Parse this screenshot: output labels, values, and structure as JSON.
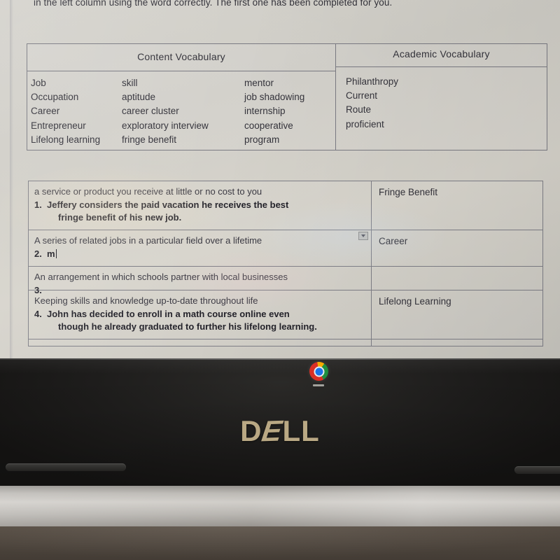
{
  "document": {
    "instruction": "in the left column using the word correctly. The first one has been completed for you."
  },
  "vocab_table": {
    "headers": {
      "content": "Content Vocabulary",
      "academic": "Academic Vocabulary"
    },
    "content_columns": [
      [
        "Job",
        "Occupation",
        "Career",
        "Entrepreneur",
        "Lifelong learning"
      ],
      [
        "skill",
        "aptitude",
        "career cluster",
        "exploratory interview",
        "fringe benefit"
      ],
      [
        "mentor",
        "job shadowing",
        "internship",
        "cooperative",
        "program"
      ]
    ],
    "academic_words": [
      "Philanthropy",
      "Current",
      "Route",
      "proficient"
    ]
  },
  "answer_table": {
    "rows": [
      {
        "definition": "a service or product you receive at little or no cost to you",
        "number": "1.",
        "sentence_line1": "Jeffery considers the paid vacation he receives the best",
        "sentence_line2": "fringe benefit of his new job.",
        "answer": "Fringe Benefit",
        "has_dropdown": false,
        "has_caret": false
      },
      {
        "definition": "A series of related jobs in a particular field over a lifetime",
        "number": "2.",
        "sentence_line1": "m",
        "sentence_line2": "",
        "answer": "Career",
        "has_dropdown": true,
        "has_caret": true
      },
      {
        "definition": "An arrangement in which schools partner with local businesses",
        "number": "3.",
        "sentence_line1": "",
        "sentence_line2": "",
        "answer": "",
        "has_dropdown": false,
        "has_caret": false
      },
      {
        "definition": "Keeping skills and knowledge up-to-date throughout life",
        "number": "4.",
        "sentence_line1": "John has decided to enroll in a math course online even",
        "sentence_line2": "though he already graduated to further his lifelong learning.",
        "answer": "Lifelong Learning",
        "has_dropdown": false,
        "has_caret": false
      }
    ]
  },
  "laptop": {
    "brand": "D",
    "brand_slant": "E",
    "brand_rest": "LL",
    "brand_full": "DELL",
    "colors": {
      "brand_text": "#b9a884",
      "bezel": "#1e1d1c",
      "screen_paper": "#d4d2cc",
      "chrome_red": "#d93025",
      "chrome_yellow": "#f9ab00",
      "chrome_green": "#1e8e3e",
      "chrome_blue": "#1a73e8"
    }
  }
}
